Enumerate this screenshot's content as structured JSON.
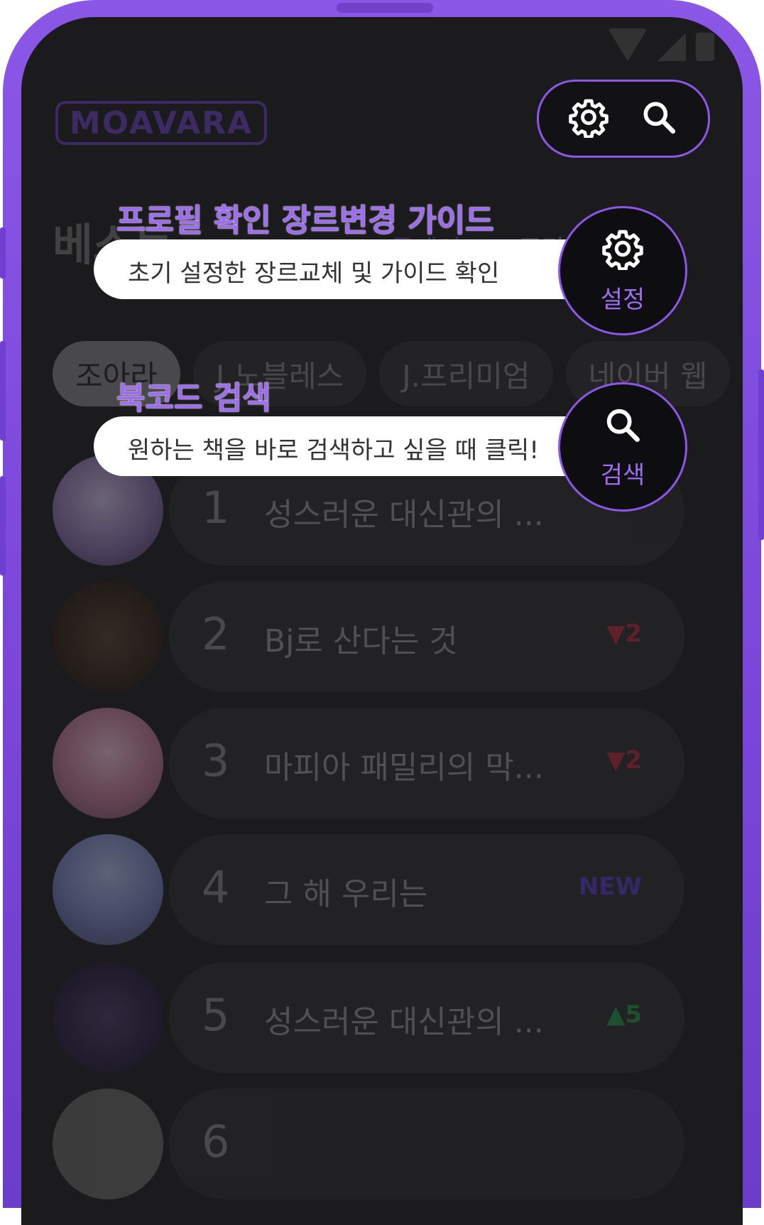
{
  "app": {
    "logo": "MOAVARA",
    "section_title": "베스트",
    "tabs": [
      {
        "label": "투데이",
        "active": true
      },
      {
        "label": "주간",
        "active": false
      }
    ],
    "platform_chips": [
      {
        "label": "조아라",
        "active": true
      },
      {
        "label": "J.노블레스",
        "active": false
      },
      {
        "label": "J.프리미엄",
        "active": false
      },
      {
        "label": "네이버 웹",
        "active": false
      }
    ],
    "ranking": [
      {
        "rank": "1",
        "title": "성스러운 대신관의 ...",
        "change": "",
        "change_type": "none"
      },
      {
        "rank": "2",
        "title": "Bj로 산다는 것",
        "change": "▼2",
        "change_type": "down"
      },
      {
        "rank": "3",
        "title": "마피아 패밀리의 막...",
        "change": "▼2",
        "change_type": "down"
      },
      {
        "rank": "4",
        "title": "그 해 우리는",
        "change": "NEW",
        "change_type": "new"
      },
      {
        "rank": "5",
        "title": "성스러운 대신관의 ...",
        "change": "▲5",
        "change_type": "up"
      },
      {
        "rank": "6",
        "title": "",
        "change": "",
        "change_type": "none"
      }
    ]
  },
  "guides": {
    "settings": {
      "title": "프로필 확인 장르변경 가이드",
      "description": "초기 설정한 장르교체 및 가이드 확인",
      "button_label": "설정",
      "icon": "gear-icon"
    },
    "search": {
      "title": "북코드 검색",
      "description": "원하는 책을 바로 검색하고 싶을 때 클릭!",
      "button_label": "검색",
      "icon": "search-icon"
    }
  },
  "colors": {
    "accent": "#8a57e6",
    "frame": "#7a45d8",
    "screen_bg": "#1b1b1d",
    "rank_down": "#c0283c",
    "rank_up": "#1f9a4a",
    "rank_new": "#5a3bd0"
  }
}
